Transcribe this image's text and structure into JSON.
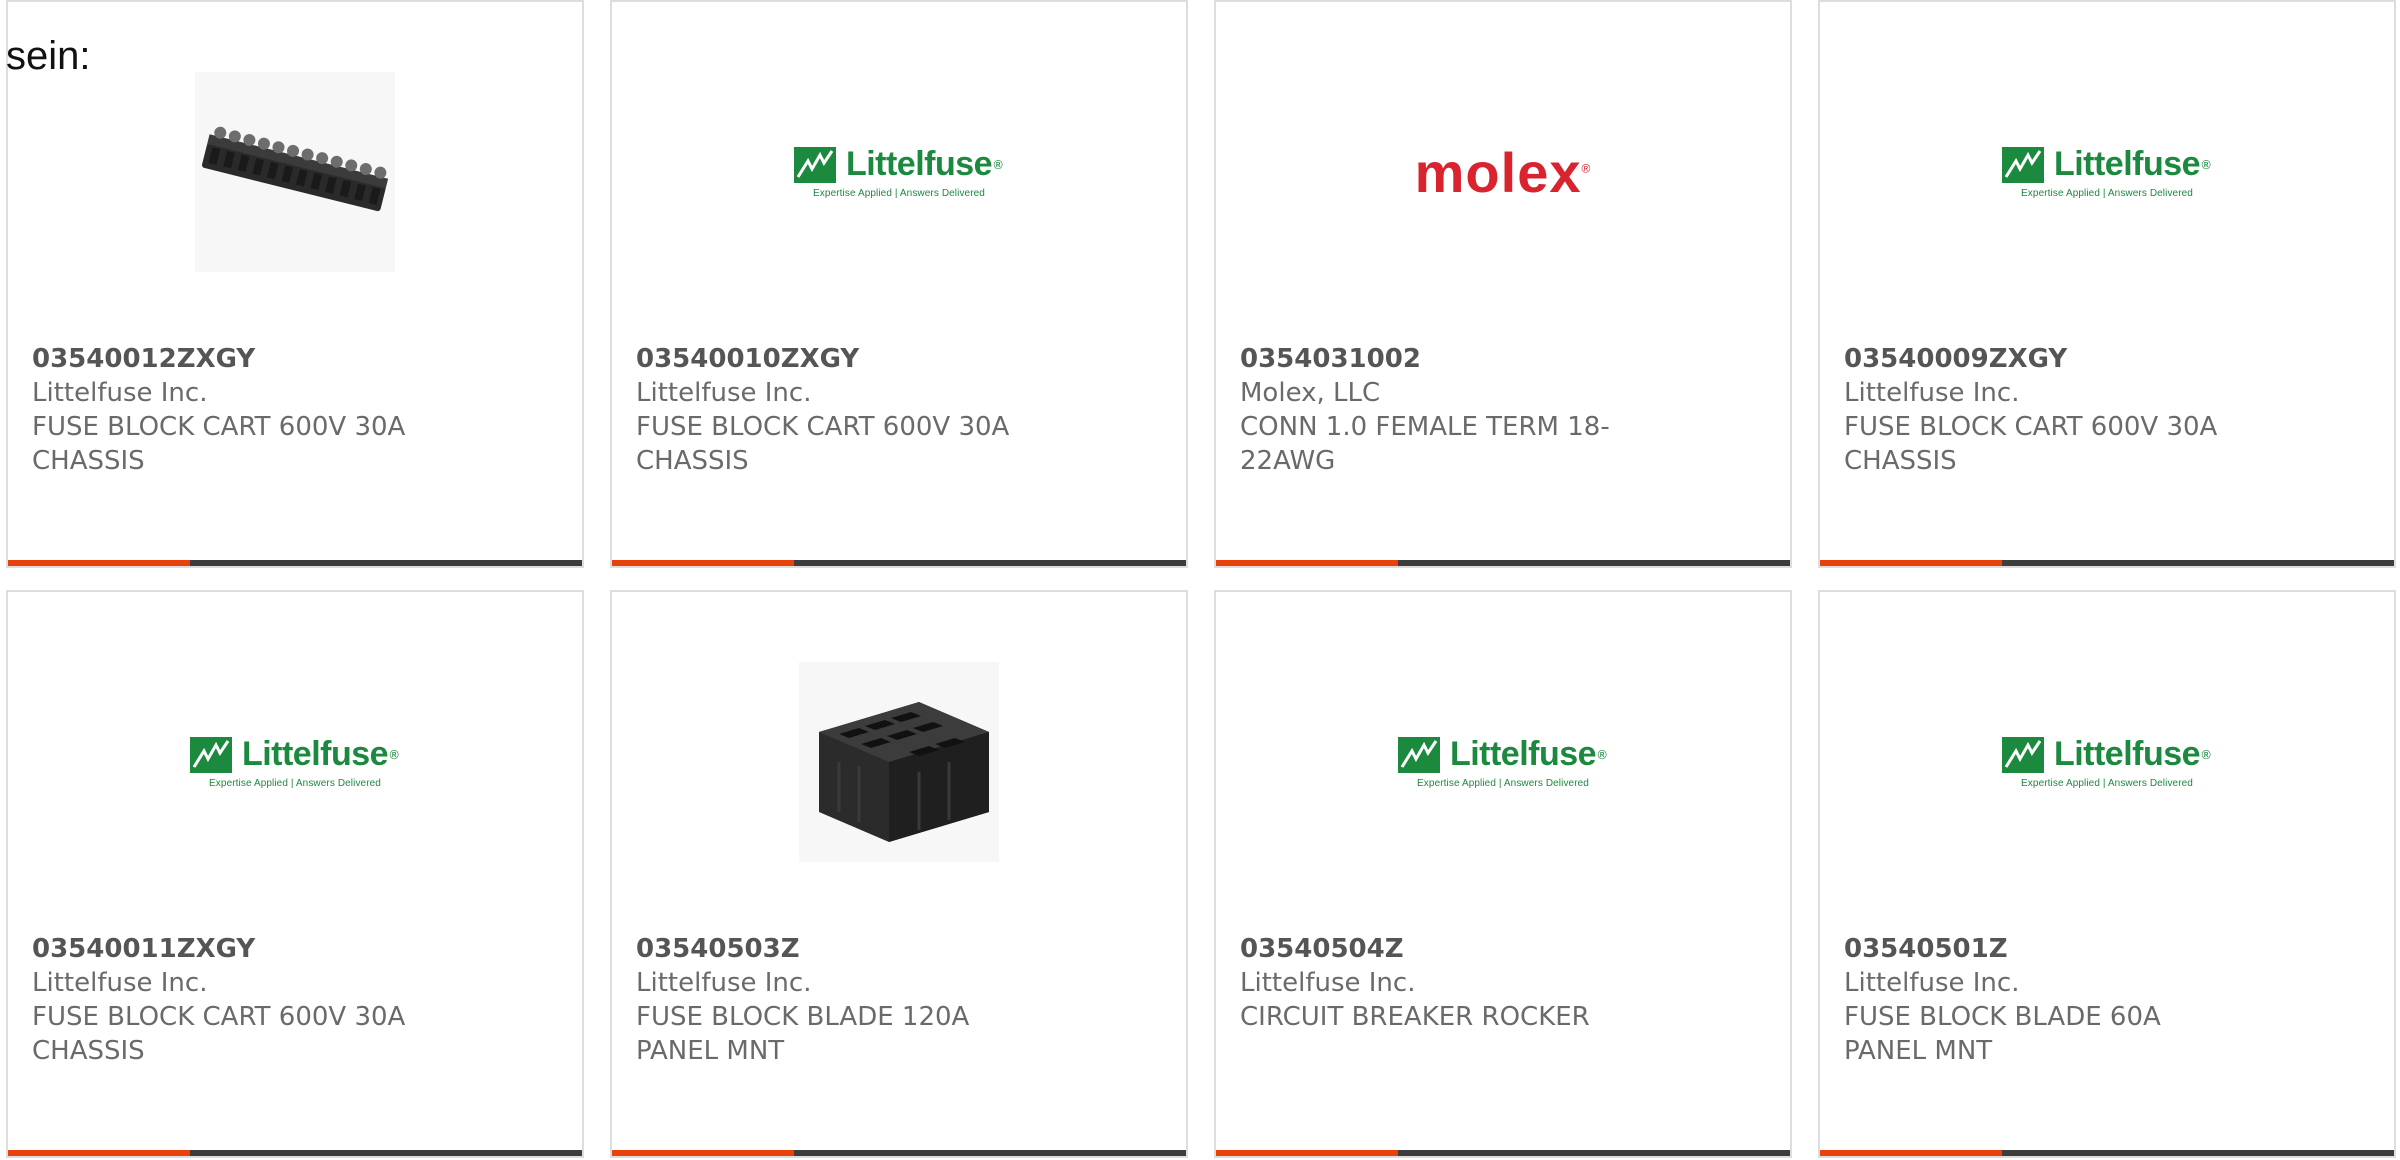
{
  "lead_text": "sein:",
  "products": [
    {
      "part_number": "03540012ZXGY",
      "manufacturer": "Littelfuse Inc.",
      "description": "FUSE BLOCK CART 600V 30A CHASSIS",
      "image": "terminal-strip-photo"
    },
    {
      "part_number": "03540010ZXGY",
      "manufacturer": "Littelfuse Inc.",
      "description": "FUSE BLOCK CART 600V 30A CHASSIS",
      "image": "littelfuse-logo"
    },
    {
      "part_number": "0354031002",
      "manufacturer": "Molex, LLC",
      "description": "CONN 1.0 FEMALE TERM 18-22AWG",
      "image": "molex-logo"
    },
    {
      "part_number": "03540009ZXGY",
      "manufacturer": "Littelfuse Inc.",
      "description": "FUSE BLOCK CART 600V 30A CHASSIS",
      "image": "littelfuse-logo"
    },
    {
      "part_number": "03540011ZXGY",
      "manufacturer": "Littelfuse Inc.",
      "description": "FUSE BLOCK CART 600V 30A CHASSIS",
      "image": "littelfuse-logo"
    },
    {
      "part_number": "03540503Z",
      "manufacturer": "Littelfuse Inc.",
      "description": "FUSE BLOCK BLADE 120A PANEL MNT",
      "image": "fuse-block-photo"
    },
    {
      "part_number": "03540504Z",
      "manufacturer": "Littelfuse Inc.",
      "description": "CIRCUIT BREAKER ROCKER",
      "image": "littelfuse-logo"
    },
    {
      "part_number": "03540501Z",
      "manufacturer": "Littelfuse Inc.",
      "description": "FUSE BLOCK BLADE 60A PANEL MNT",
      "image": "littelfuse-logo"
    }
  ],
  "logos": {
    "littelfuse": {
      "word": "Littelfuse",
      "tagline": "Expertise Applied | Answers Delivered",
      "color": "#1b8a3e"
    },
    "molex": {
      "word": "molex",
      "color": "#d9232e"
    }
  },
  "colors": {
    "accent_bar": "#e8420a",
    "dark_bar": "#3d3d3d",
    "card_border": "#dddddd",
    "text": "#6a6a6a"
  }
}
